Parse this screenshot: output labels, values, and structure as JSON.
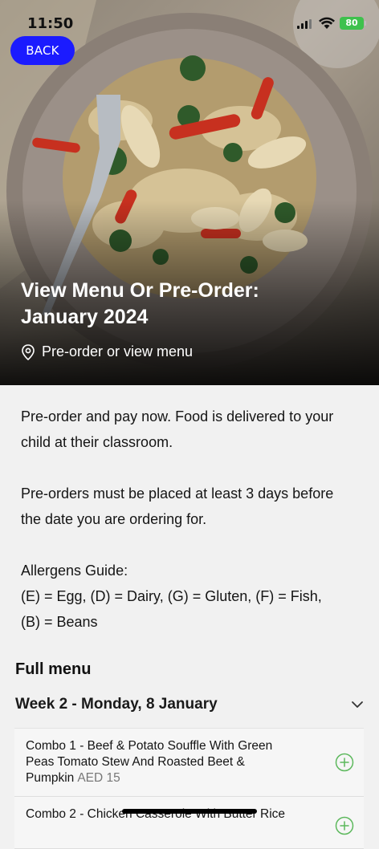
{
  "status_bar": {
    "time": "11:50",
    "battery": "80"
  },
  "header": {
    "back_label": "BACK"
  },
  "hero": {
    "title_line1": "View Menu Or Pre-Order:",
    "title_line2": "January 2024",
    "link_label": "Pre-order or view menu"
  },
  "description": {
    "p1_line1": "Pre-order and pay now. Food is delivered to your",
    "p1_line2": "child at their classroom.",
    "p2_line1": "Pre-orders must be placed at least 3 days before",
    "p2_line2": "the date you are ordering for.",
    "p3_line1": "Allergens Guide:",
    "p3_line2": "(E) = Egg, (D) = Dairy, (G) = Gluten, (F) = Fish,",
    "p3_line3": "(B) = Beans"
  },
  "menu": {
    "section_title": "Full menu",
    "week_label": "Week 2 - Monday, 8 January",
    "items": [
      {
        "name_line1": "Combo 1 - Beef & Potato Souffle With Green",
        "name_line2": "Peas Tomato Stew And Roasted Beet &",
        "name_line3": "Pumpkin",
        "price": "AED 15"
      },
      {
        "name_line1": "Combo 2 - Chicken Casserole With Butter Rice"
      }
    ]
  },
  "colors": {
    "back_button": "#1b1bff",
    "add_icon": "#5cb85c",
    "battery": "#3ec14d"
  },
  "icons": [
    "location-pin-icon",
    "chevron-down-icon",
    "add-circle-icon",
    "wifi-icon",
    "signal-icon"
  ]
}
